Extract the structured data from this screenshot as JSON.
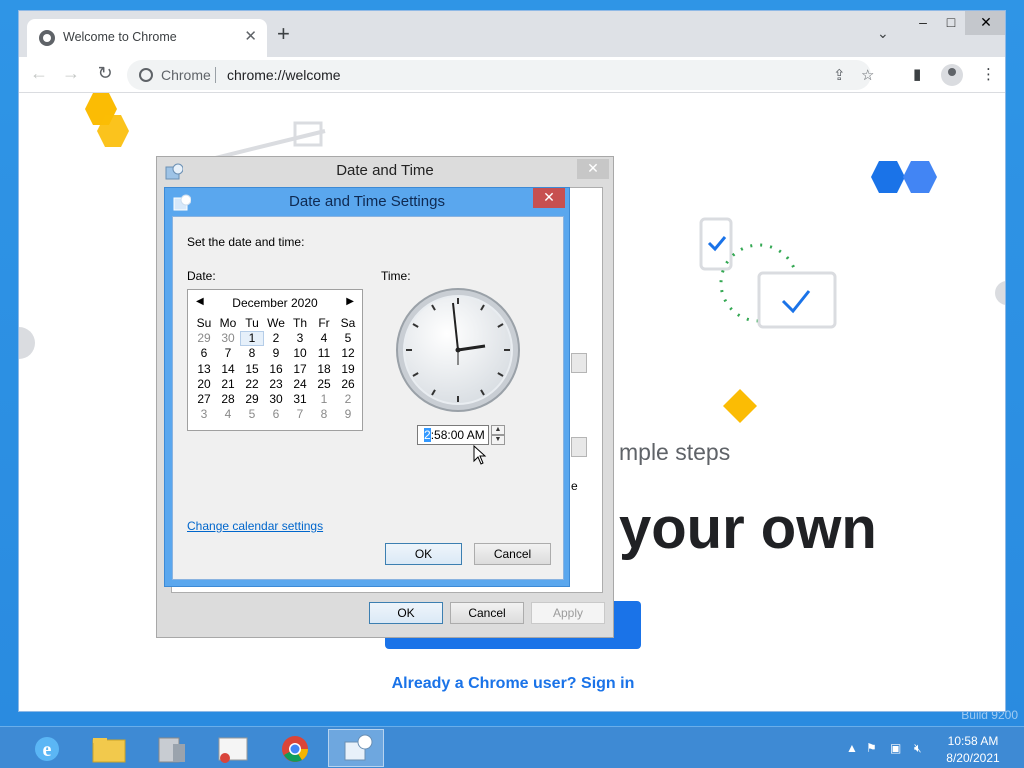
{
  "chrome": {
    "tab_title": "Welcome to Chrome",
    "site_label": "Chrome",
    "url": "chrome://welcome",
    "tab_close": "✕",
    "new_tab": "+",
    "tab_search": "⌄",
    "win_min": "–",
    "win_max": "□",
    "win_close": "✕"
  },
  "welcome": {
    "steps_text": "mple steps",
    "headline": "your own",
    "signin": "Already a Chrome user? Sign in"
  },
  "datetime_dialog": {
    "title": "Date and Time",
    "ok": "OK",
    "cancel": "Cancel",
    "apply": "Apply",
    "partial_char": "e"
  },
  "settings_dialog": {
    "title": "Date and Time Settings",
    "instruction": "Set the date and time:",
    "date_label": "Date:",
    "time_label": "Time:",
    "month_year": "December 2020",
    "weekdays": [
      "Su",
      "Mo",
      "Tu",
      "We",
      "Th",
      "Fr",
      "Sa"
    ],
    "weeks": [
      [
        "29",
        "30",
        "1",
        "2",
        "3",
        "4",
        "5"
      ],
      [
        "6",
        "7",
        "8",
        "9",
        "10",
        "11",
        "12"
      ],
      [
        "13",
        "14",
        "15",
        "16",
        "17",
        "18",
        "19"
      ],
      [
        "20",
        "21",
        "22",
        "23",
        "24",
        "25",
        "26"
      ],
      [
        "27",
        "28",
        "29",
        "30",
        "31",
        "1",
        "2"
      ],
      [
        "3",
        "4",
        "5",
        "6",
        "7",
        "8",
        "9"
      ]
    ],
    "time_hour": "2",
    "time_rest": ":58:00 AM",
    "change_calendar_link": "Change calendar settings",
    "ok": "OK",
    "cancel": "Cancel"
  },
  "taskbar": {
    "clock_time": "10:58 AM",
    "clock_date": "8/20/2021",
    "watermark": "Build 9200"
  },
  "colors": {
    "chrome_blue": "#1a73e8",
    "dialog_active": "#5aa7ee",
    "close_red": "#c75050",
    "taskbar": "#3e8ad4"
  }
}
